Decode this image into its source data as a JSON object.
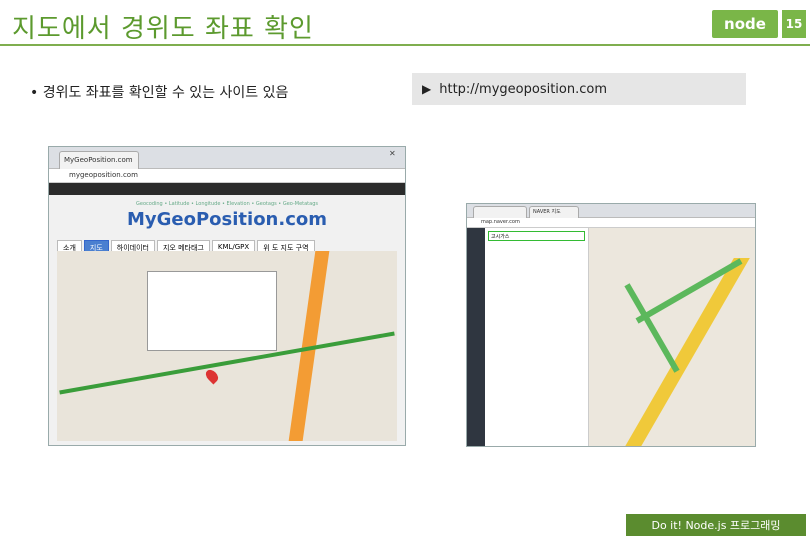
{
  "slide": {
    "title": "지도에서 경위도 좌표 확인",
    "page_number": "15",
    "logo_text": "node",
    "bullet": "• 경위도 좌표를 확인할 수 있는 사이트 있음",
    "url": "http://mygeoposition.com",
    "footer": "Do it! Node.js 프로그래밍"
  },
  "screenshot1": {
    "tab_label": "MyGeoPosition.com",
    "address": "mygeoposition.com",
    "site_logo": "MyGeoPosition.com",
    "site_tagline": "Geocoding • Latitude • Longitude • Elevation • Geotags • Geo-Metatags",
    "tabs": [
      "소개",
      "지도",
      "하이데이터",
      "지오 메타태그",
      "KML/GPX",
      "위 도 지도 구역"
    ]
  },
  "screenshot2": {
    "tab_label": "NAVER 지도",
    "address": "map.naver.com",
    "search_value": "고시가스"
  },
  "colors": {
    "accent": "#7ab648",
    "title": "#5c9a2e",
    "footer_bg": "#5b8c2f",
    "url_box": "#e6e6e6"
  }
}
